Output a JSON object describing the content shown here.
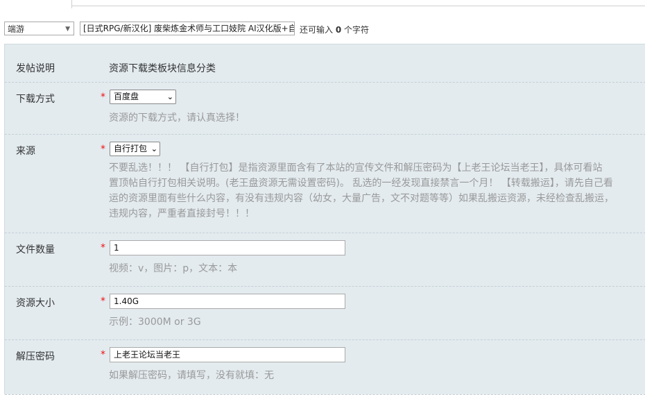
{
  "type_select": {
    "value": "端游",
    "arrow": "▼"
  },
  "subject": {
    "value": "[日式RPG/新汉化] 废柴炼金术师与工口妓院 AI汉化版+自"
  },
  "remain": {
    "prefix": "还可输入",
    "count": "0",
    "suffix": "个字符"
  },
  "fields": {
    "post_note": {
      "label": "发帖说明",
      "value": "资源下载类板块信息分类"
    },
    "download": {
      "label": "下载方式",
      "star": "*",
      "selected": "百度盘",
      "hint": "资源的下载方式，请认真选择！"
    },
    "source": {
      "label": "来源",
      "star": "*",
      "selected": "自行打包",
      "hint_lines": [
        "不要乱选！！！ 【自行打包】是指资源里面含有了本站的宣传文件和解压密码为【上老王论坛当老王】，具体可看站",
        "置顶帖自行打包相关说明。(老王盘资源无需设置密码)。 乱选的一经发现直接禁言一个月！ 【转载搬运】，请先自己看",
        "运的资源里面有些什么内容，有没有违规内容（幼女，大量广告，文不对题等等）如果乱搬运资源，未经检查乱搬运，",
        "违规内容，严重者直接封号！！！"
      ]
    },
    "file_count": {
      "label": "文件数量",
      "star": "*",
      "value": "1",
      "hint": "视频：v，图片：p，文本：本"
    },
    "size": {
      "label": "资源大小",
      "star": "*",
      "value": "1.40G",
      "hint": "示例：3000M or 3G"
    },
    "password": {
      "label": "解压密码",
      "star": "*",
      "value": "上老王论坛当老王",
      "hint": "如果解压密码，请填写，没有就填：无"
    }
  },
  "icons": {
    "chevron": "chevron-down-icon"
  }
}
